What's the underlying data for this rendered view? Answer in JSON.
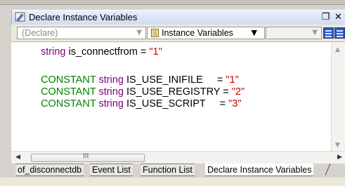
{
  "window": {
    "title": "Declare Instance Variables",
    "restore_glyph": "❐",
    "close_glyph": "✕"
  },
  "toolbar": {
    "object_combo": {
      "value": "(Declare)",
      "enabled": false
    },
    "event_combo": {
      "value": "Instance Variables"
    },
    "extra_combo": {
      "value": "",
      "enabled": false
    }
  },
  "code": {
    "lines": [
      {
        "type": "string",
        "name": "is_connectfrom",
        "op": " = ",
        "value": "\"1\""
      },
      {
        "constant": "CONSTANT",
        "type": "string",
        "name": "IS_USE_INIFILE",
        "op": "     = ",
        "value": "\"1\""
      },
      {
        "constant": "CONSTANT",
        "type": "string",
        "name": "IS_USE_REGISTRY",
        "op": " = ",
        "value": "\"2\""
      },
      {
        "constant": "CONSTANT",
        "type": "string",
        "name": "IS_USE_SCRIPT",
        "op": "     = ",
        "value": "\"3\""
      }
    ]
  },
  "scrollbar": {
    "grip": "III"
  },
  "tabs": [
    {
      "label": "of_disconnectdb",
      "active": false
    },
    {
      "label": "Event List",
      "active": false
    },
    {
      "label": "Function List",
      "active": false
    },
    {
      "label": "Declare Instance Variables",
      "active": true
    }
  ],
  "colors": {
    "keyword": "#008000",
    "type": "#800080",
    "literal": "#cc0000",
    "title_bar": "#cfdcf2"
  },
  "icons": [
    "script-window-icon",
    "restore-icon",
    "close-icon",
    "instance-variables-icon",
    "layout-icon"
  ]
}
